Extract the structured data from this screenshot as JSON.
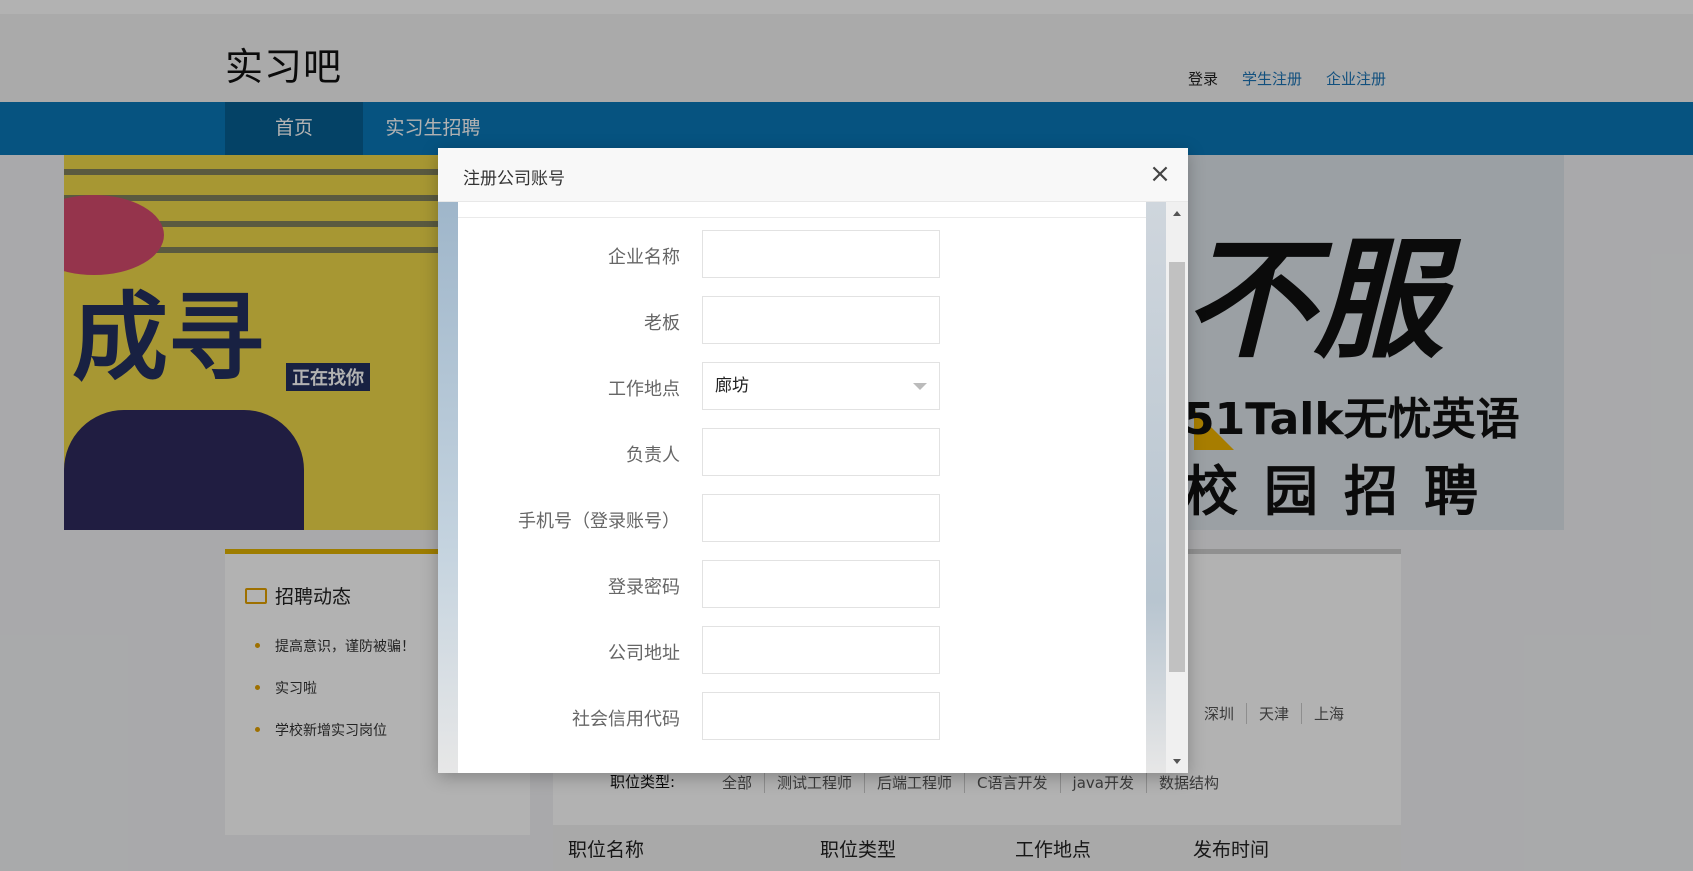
{
  "header": {
    "logo": "实习吧",
    "login": "登录",
    "student_register": "学生注册",
    "company_register": "企业注册"
  },
  "nav": {
    "home": "首页",
    "intern": "实习生招聘"
  },
  "banner": {
    "left_big": "成寻",
    "left_small": "正在找你",
    "right_big": "不服",
    "right_talk": "51Talk无忧英语",
    "right_campus": "校园招聘"
  },
  "news": {
    "title": "招聘动态",
    "items": [
      "提高意识，谨防被骗！",
      "实习啦",
      "学校新增实习岗位"
    ]
  },
  "jobs": {
    "cities": [
      "深圳",
      "天津",
      "上海"
    ],
    "type_label": "职位类型:",
    "types": [
      "全部",
      "测试工程师",
      "后端工程师",
      "C语言开发",
      "java开发",
      "数据结构"
    ],
    "columns": [
      "职位名称",
      "职位类型",
      "工作地点",
      "发布时间"
    ]
  },
  "modal": {
    "title": "注册公司账号",
    "close": "×",
    "fields": [
      {
        "label": "企业名称",
        "value": ""
      },
      {
        "label": "老板",
        "value": ""
      },
      {
        "label": "工作地点",
        "value": "廊坊"
      },
      {
        "label": "负责人",
        "value": ""
      },
      {
        "label": "手机号（登录账号）",
        "value": ""
      },
      {
        "label": "登录密码",
        "value": ""
      },
      {
        "label": "公司地址",
        "value": ""
      },
      {
        "label": "社会信用代码",
        "value": ""
      }
    ]
  }
}
